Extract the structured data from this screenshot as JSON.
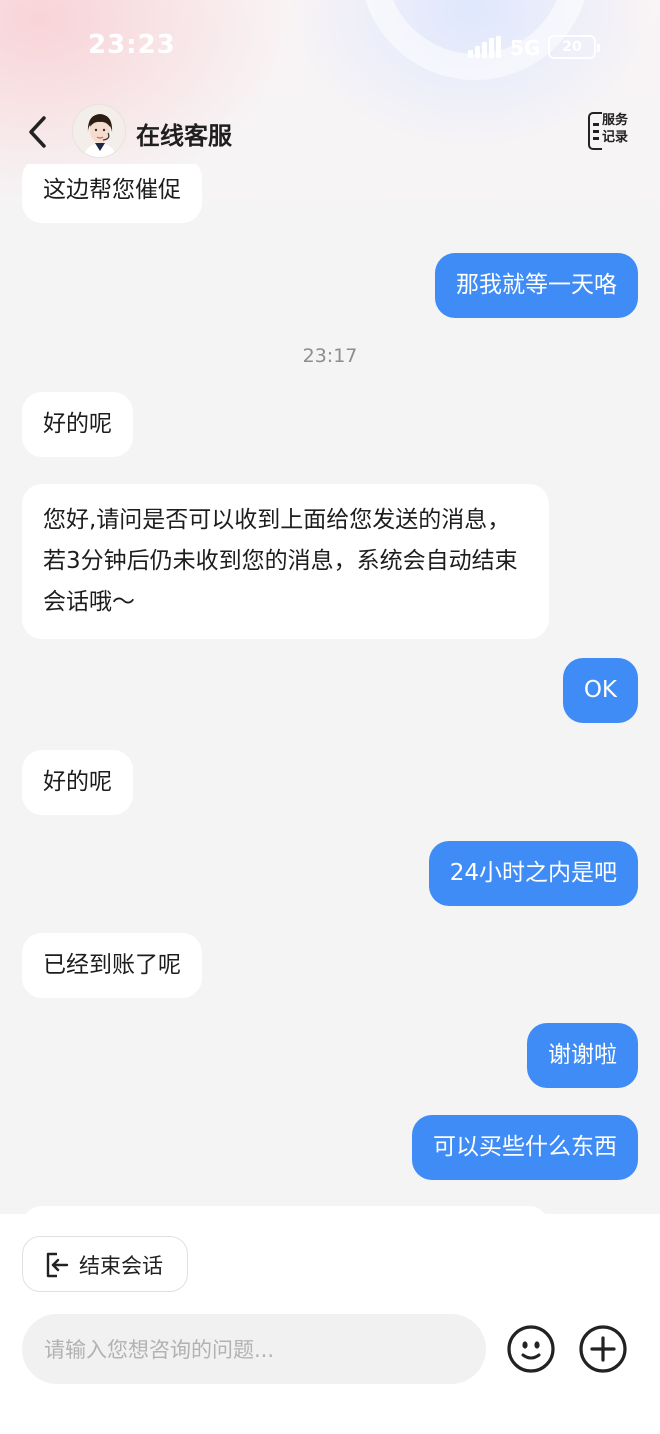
{
  "status_bar": {
    "time": "23:23",
    "network": "5G",
    "battery": "20"
  },
  "header": {
    "title": "在线客服",
    "record_button": [
      "服务",
      "记录"
    ]
  },
  "messages": [
    {
      "side": "in",
      "text": "这边帮您催促"
    },
    {
      "side": "out",
      "text": "那我就等一天咯"
    },
    {
      "side": "timestamp",
      "text": "23:17"
    },
    {
      "side": "in",
      "text": "好的呢"
    },
    {
      "side": "in",
      "text": "您好,请问是否可以收到上面给您发送的消息，若3分钟后仍未收到您的消息，系统会自动结束会话哦～"
    },
    {
      "side": "out",
      "text": "OK"
    },
    {
      "side": "in",
      "text": "好的呢"
    },
    {
      "side": "out",
      "text": "24小时之内是吧"
    },
    {
      "side": "in",
      "text": "已经到账了呢"
    },
    {
      "side": "out",
      "text": "谢谢啦"
    },
    {
      "side": "out",
      "text": "可以买些什么东西"
    }
  ],
  "bottom": {
    "end_session_label": "结束会话",
    "input_placeholder": "请输入您想咨询的问题..."
  },
  "colors": {
    "outgoing_bubble": "#3f8cf6",
    "incoming_bubble": "#ffffff",
    "background": "#f4f4f5"
  },
  "icons": [
    "back-chevron-icon",
    "agent-avatar",
    "service-record-icon",
    "exit-icon",
    "emoji-icon",
    "plus-icon"
  ]
}
